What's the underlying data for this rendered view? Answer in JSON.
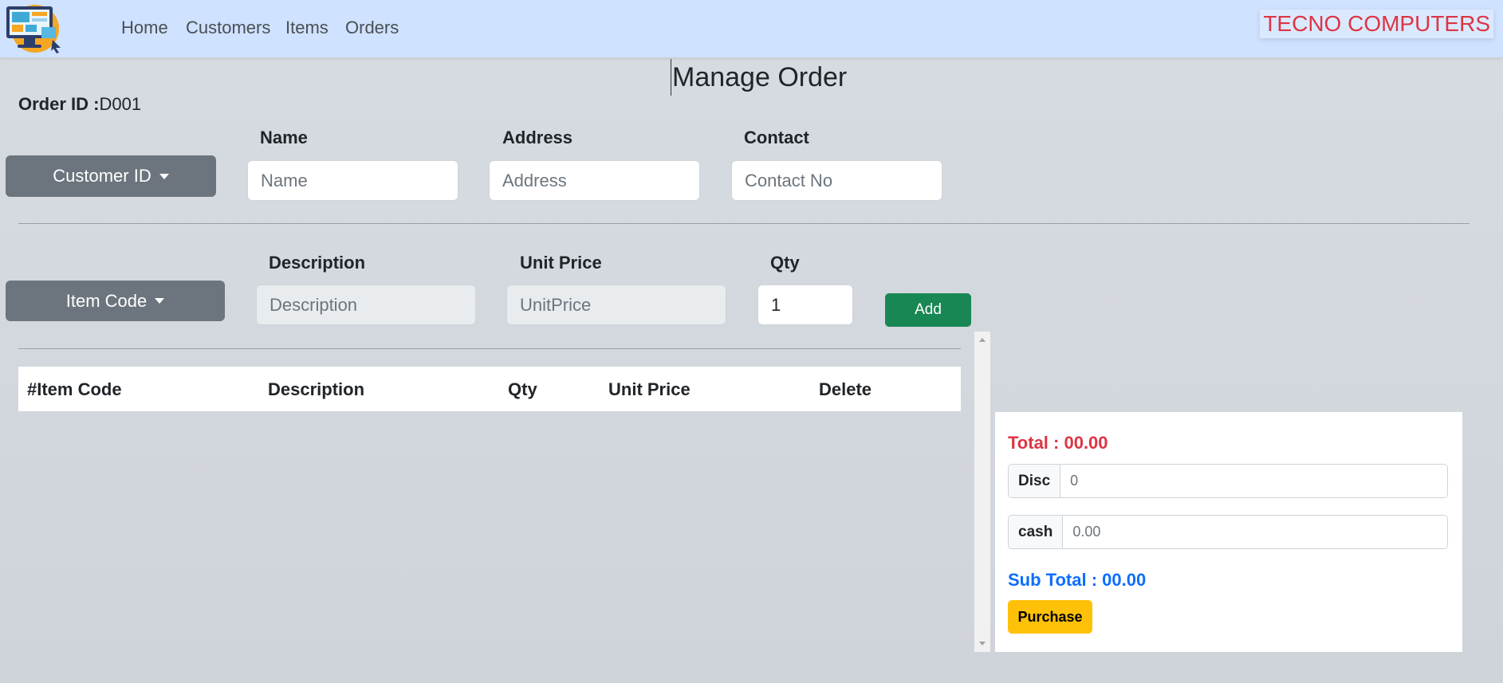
{
  "nav": {
    "logo_icon": "computer-monitor-logo",
    "links": [
      "Home",
      "Customers",
      "Items",
      "Orders"
    ],
    "brand": "TECNO COMPUTERS"
  },
  "page": {
    "title": "Manage Order",
    "order_id_label": "Order ID :",
    "order_id_value": "D001"
  },
  "customer": {
    "dropdown_label": "Customer ID",
    "name_label": "Name",
    "name_placeholder": "Name",
    "address_label": "Address",
    "address_placeholder": "Address",
    "contact_label": "Contact",
    "contact_placeholder": "Contact No"
  },
  "item": {
    "dropdown_label": "Item Code",
    "description_label": "Description",
    "description_placeholder": "Description",
    "unit_price_label": "Unit Price",
    "unit_price_placeholder": "UnitPrice",
    "qty_label": "Qty",
    "qty_value": "1",
    "add_label": "Add"
  },
  "table": {
    "columns": [
      "#Item Code",
      "Description",
      "Qty",
      "Unit Price",
      "Delete"
    ],
    "rows": []
  },
  "summary": {
    "total": "Total : 00.00",
    "disc_label": "Disc",
    "disc_placeholder": "0",
    "cash_label": "cash",
    "cash_placeholder": "0.00",
    "subtotal": "Sub Total : 00.00",
    "purchase_label": "Purchase"
  },
  "colors": {
    "navbar": "#cfe2ff",
    "brand": "#dc3545",
    "dropdown_button": "#6c757d",
    "add_button": "#198754",
    "total": "#dc3545",
    "subtotal": "#0d6efd",
    "purchase_button": "#ffc107"
  }
}
